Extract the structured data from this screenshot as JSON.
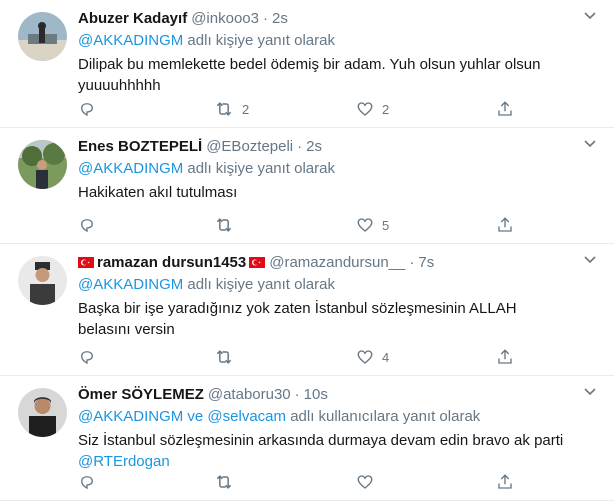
{
  "tweets": [
    {
      "name": "Abuzer Kadayıf",
      "handle": "@inkooo3",
      "time": "2s",
      "reply_mention": "@AKKADINGM",
      "reply_suffix": "adlı kişiye yanıt olarak",
      "text": "Dilipak bu memlekette bedel ödemiş bir adam. Yuh olsun yuhlar olsun yuuuuhhhhh",
      "retweets": "2",
      "likes": "2"
    },
    {
      "name": "Enes BOZTEPELİ",
      "handle": "@EBoztepeli",
      "time": "2s",
      "reply_mention": "@AKKADINGM",
      "reply_suffix": "adlı kişiye yanıt olarak",
      "text": "Hakikaten akıl tutulması",
      "retweets": "",
      "likes": "5"
    },
    {
      "name": "ramazan dursun1453",
      "handle": "@ramazandursun__",
      "time": "7s",
      "reply_mention": "@AKKADINGM",
      "reply_suffix": "adlı kişiye yanıt olarak",
      "text": "Başka bir işe yaradığınız yok zaten İstanbul sözleşmesinin ALLAH belasını versin",
      "retweets": "",
      "likes": "4"
    },
    {
      "name": "Ömer SÖYLEMEZ",
      "handle": "@ataboru30",
      "time": "10s",
      "reply_mention": "@AKKADINGM ve @selvacam",
      "reply_suffix": "adlı kullanıcılara yanıt olarak",
      "text": "Siz İstanbul sözleşmesinin arkasında durmaya devam edin bravo ak parti",
      "text_mention": "@RTErdogan",
      "retweets": "",
      "likes": ""
    }
  ],
  "icons": {
    "reply": "reply-icon",
    "retweet": "retweet-icon",
    "like": "heart-icon",
    "share": "share-icon",
    "more": "chevron-down-icon",
    "flag": "turkish-flag-icon"
  },
  "colors": {
    "link": "#1b95e0",
    "secondary": "#657786",
    "text": "#14171a",
    "divider": "#e6ecf0",
    "flag": "#e30a17"
  }
}
